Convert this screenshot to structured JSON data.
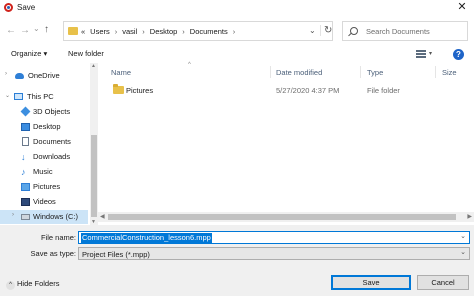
{
  "window": {
    "title": "Save",
    "close_glyph": "✕"
  },
  "nav": {
    "back_glyph": "←",
    "forward_glyph": "→",
    "dropdown_glyph": "⌄",
    "up_glyph": "↑",
    "breadcrumbs": [
      "«",
      "Users",
      "vasil",
      "Desktop",
      "Documents"
    ],
    "breadcrumb_separator": "›",
    "address_dropdown_glyph": "⌄",
    "refresh_glyph": "↻",
    "search_placeholder": "Search Documents"
  },
  "toolbar": {
    "organize_label": "Organize ▾",
    "new_folder_label": "New folder",
    "help_glyph": "?",
    "view_caret": "▾"
  },
  "sidebar": {
    "items": [
      {
        "label": "OneDrive",
        "icon": "onedrive-icon"
      },
      {
        "label": "This PC",
        "icon": "computer-icon"
      },
      {
        "label": "3D Objects",
        "icon": "3d-objects-icon"
      },
      {
        "label": "Desktop",
        "icon": "desktop-icon"
      },
      {
        "label": "Documents",
        "icon": "documents-icon"
      },
      {
        "label": "Downloads",
        "icon": "downloads-icon"
      },
      {
        "label": "Music",
        "icon": "music-icon"
      },
      {
        "label": "Pictures",
        "icon": "pictures-icon"
      },
      {
        "label": "Videos",
        "icon": "videos-icon"
      },
      {
        "label": "Windows (C:)",
        "icon": "drive-icon"
      }
    ],
    "expand_glyph": "›",
    "expanded_glyph": "⌄"
  },
  "columns": {
    "name": "Name",
    "date_modified": "Date modified",
    "type": "Type",
    "size": "Size",
    "sort_glyph": "^"
  },
  "files": [
    {
      "name": "Pictures",
      "date_modified": "5/27/2020 4:37 PM",
      "type": "File folder",
      "size": ""
    }
  ],
  "form": {
    "file_name_label": "File name:",
    "file_name_value": "CommercialConstruction_lesson6.mpp",
    "save_as_type_label": "Save as type:",
    "save_as_type_value": "Project Files (*.mpp)",
    "dropdown_glyph": "⌄"
  },
  "footer": {
    "hide_folders_label": "Hide Folders",
    "hide_folders_glyph": "^",
    "save_label": "Save",
    "cancel_label": "Cancel"
  },
  "colors": {
    "accent": "#0078d7",
    "selection_bg": "#cce4f7",
    "folder": "#e8c14a",
    "form_bg": "#f0f0f0"
  }
}
